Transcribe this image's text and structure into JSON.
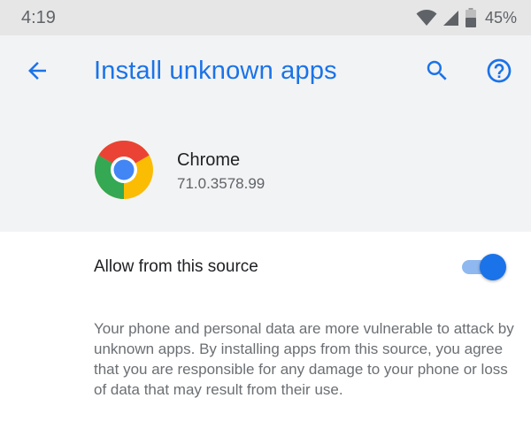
{
  "status_bar": {
    "time": "4:19",
    "battery_percent": "45%",
    "icons": [
      "wifi-icon",
      "signal-icon",
      "battery-icon"
    ]
  },
  "toolbar": {
    "title": "Install unknown apps",
    "back_icon": "arrow-back-icon",
    "search_icon": "search-icon",
    "help_icon": "help-icon"
  },
  "app": {
    "name": "Chrome",
    "version": "71.0.3578.99",
    "icon": "chrome-icon"
  },
  "setting": {
    "label": "Allow from this source",
    "enabled": true
  },
  "warning": {
    "text": "Your phone and personal data are more vulnerable to attack by unknown apps. By installing apps from this source, you agree that you are responsible for any damage to your phone or loss of data that may result from their use."
  },
  "colors": {
    "accent": "#1a73e8",
    "header_bg": "#f2f3f4",
    "status_bg": "#e6e6e6"
  }
}
